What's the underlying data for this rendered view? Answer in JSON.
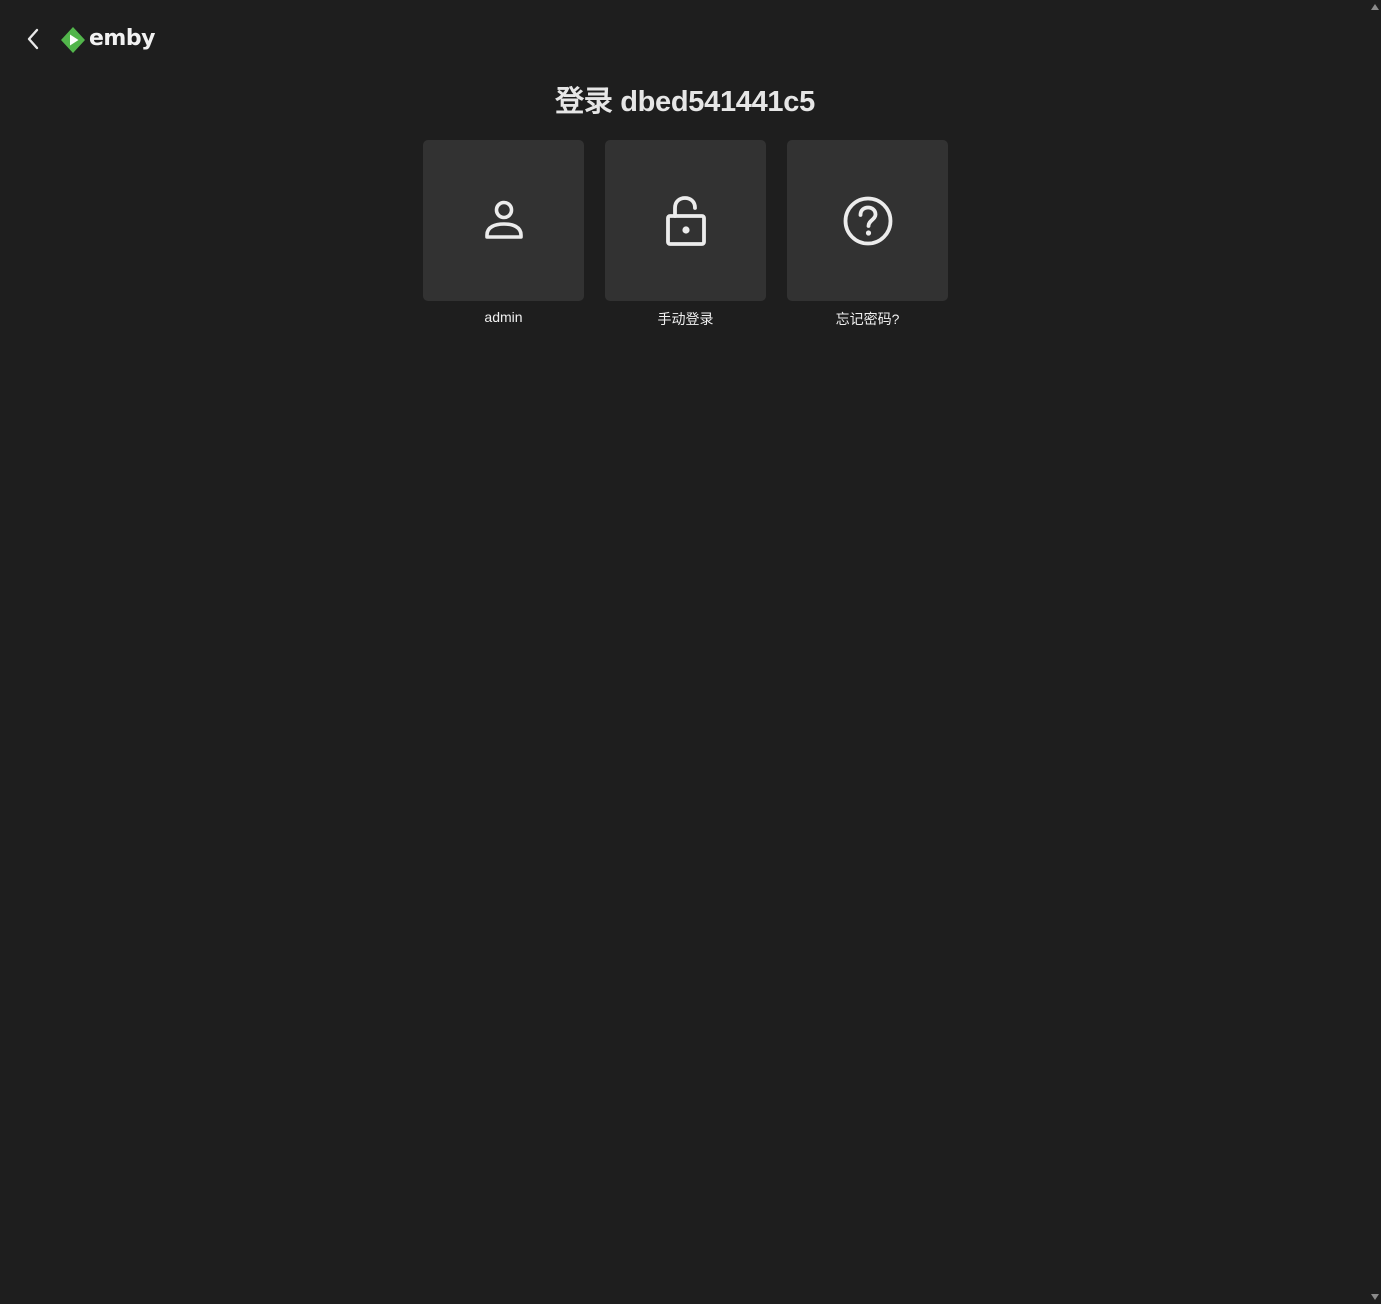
{
  "header": {
    "back_icon": "chevron-left-icon",
    "logo_text": "emby",
    "logo_icon": "emby-play-diamond-icon"
  },
  "title": "登录 dbed541441c5",
  "cards": [
    {
      "label": "admin",
      "icon": "user-icon"
    },
    {
      "label": "手动登录",
      "icon": "unlock-icon"
    },
    {
      "label": "忘记密码?",
      "icon": "help-circle-icon"
    }
  ],
  "colors": {
    "background": "#1e1e1e",
    "card": "#323232",
    "brand_green": "#52b54b",
    "icon": "#ececec"
  }
}
